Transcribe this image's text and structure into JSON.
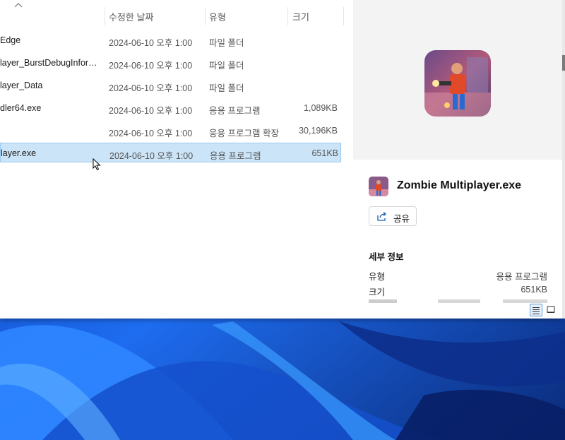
{
  "columns": {
    "date": "수정한 날짜",
    "type": "유형",
    "size": "크기"
  },
  "files": [
    {
      "name": "Edge",
      "date": "2024-06-10 오후 1:00",
      "type": "파일 폴더",
      "size": ""
    },
    {
      "name": "layer_BurstDebugInforma...",
      "date": "2024-06-10 오후 1:00",
      "type": "파일 폴더",
      "size": ""
    },
    {
      "name": "layer_Data",
      "date": "2024-06-10 오후 1:00",
      "type": "파일 폴더",
      "size": ""
    },
    {
      "name": "dler64.exe",
      "date": "2024-06-10 오후 1:00",
      "type": "응용 프로그램",
      "size": "1,089KB"
    },
    {
      "name": "",
      "date": "2024-06-10 오후 1:00",
      "type": "응용 프로그램 확장",
      "size": "30,196KB"
    },
    {
      "name": "layer.exe",
      "date": "2024-06-10 오후 1:00",
      "type": "응용 프로그램",
      "size": "651KB"
    }
  ],
  "selected_index": 5,
  "details": {
    "file_name": "Zombie Multiplayer.exe",
    "share_label": "공유",
    "section_title": "세부 정보",
    "props": [
      {
        "key": "유형",
        "value": "응용 프로그램"
      },
      {
        "key": "크기",
        "value": "651KB"
      }
    ]
  },
  "colors": {
    "selection": "#cce4f7",
    "selection_border": "#99c9ef",
    "preview_bg": "#f3f3f3",
    "accent": "#5b9bd5"
  }
}
